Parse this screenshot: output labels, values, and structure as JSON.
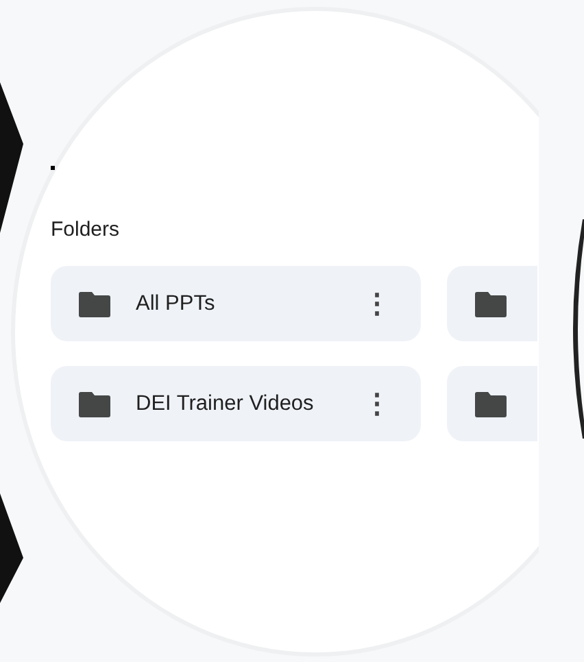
{
  "section": {
    "title": "Folders"
  },
  "folders": [
    {
      "kind": "folder",
      "name": "All PPTs",
      "menu": "⋮"
    },
    {
      "kind": "folder"
    },
    {
      "kind": "folder",
      "name": "DEI Trainer Videos",
      "menu": "⋮"
    },
    {
      "kind": "folder"
    }
  ]
}
